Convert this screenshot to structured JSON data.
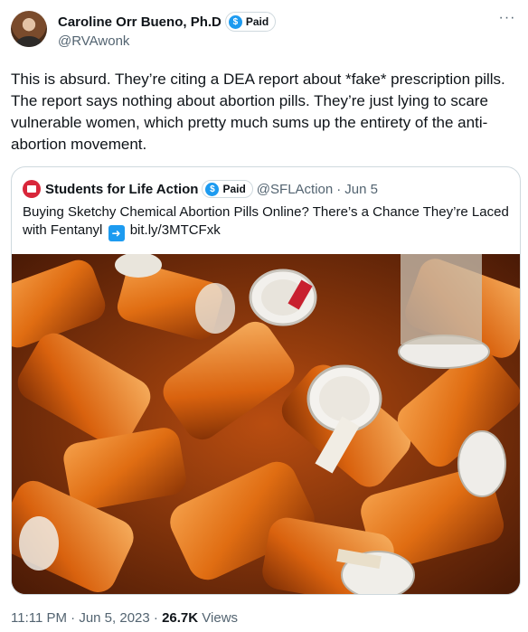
{
  "author": {
    "display_name": "Caroline Orr Bueno, Ph.D",
    "badge_label": "Paid",
    "handle": "@RVAwonk",
    "avatar_icon": "user-avatar"
  },
  "tweet": {
    "text": "This is absurd. They’re citing a DEA report about *fake* prescription pills. The report says nothing about abortion pills. They’re just lying to scare vulnerable women, which pretty much sums up the entirety of the anti-abortion movement."
  },
  "quote": {
    "display_name": "Students for Life Action",
    "badge_label": "Paid",
    "handle": "@SFLAction",
    "separator": "·",
    "date": "Jun 5",
    "text_before_link": "Buying Sketchy Chemical Abortion Pills Online? There’s a Chance They’re Laced with Fentanyl",
    "link_text": "bit.ly/3MTCFxk",
    "arrow_icon": "arrow-right-icon",
    "media_description_icon": "pill-bottles-photo"
  },
  "meta": {
    "time": "11:11 PM",
    "sep1": "·",
    "date": "Jun 5, 2023",
    "sep2": "·",
    "views_count": "26.7K",
    "views_label": "Views"
  },
  "colors": {
    "link_blue": "#1d9bf0",
    "secondary_text": "#536471",
    "border": "#cfd9de",
    "orange_bottle": "#e8791d"
  }
}
